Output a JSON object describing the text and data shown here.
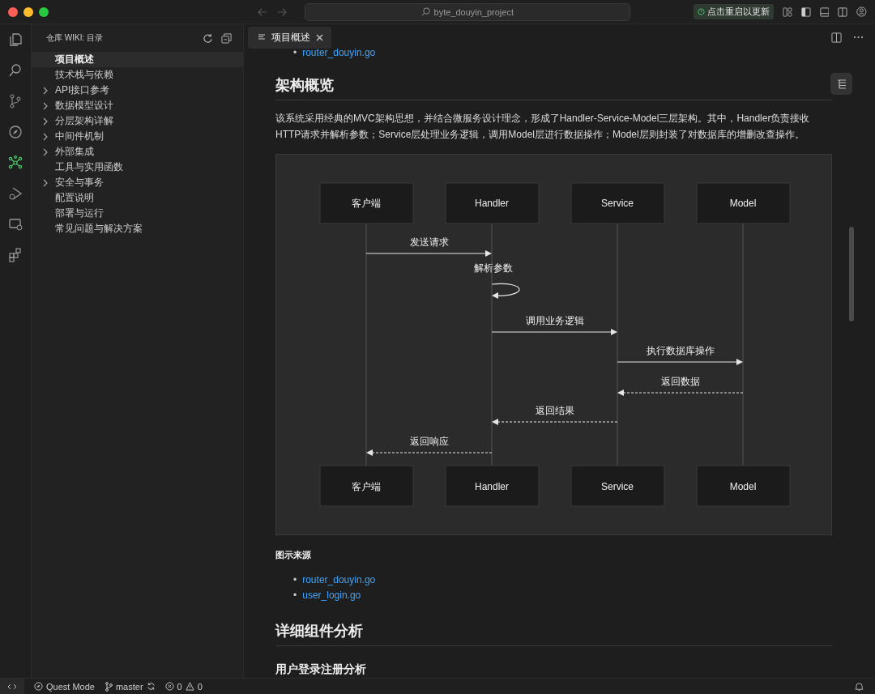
{
  "window": {
    "title": "byte_douyin_project",
    "update_badge": "点击重启以更新"
  },
  "sidebar": {
    "title": "仓库 WIKI: 目录",
    "items": [
      {
        "label": "项目概述",
        "expandable": false,
        "selected": true
      },
      {
        "label": "技术栈与依赖",
        "expandable": false,
        "selected": false
      },
      {
        "label": "API接口参考",
        "expandable": true,
        "selected": false
      },
      {
        "label": "数据模型设计",
        "expandable": true,
        "selected": false
      },
      {
        "label": "分层架构详解",
        "expandable": true,
        "selected": false
      },
      {
        "label": "中间件机制",
        "expandable": true,
        "selected": false
      },
      {
        "label": "外部集成",
        "expandable": true,
        "selected": false
      },
      {
        "label": "工具与实用函数",
        "expandable": false,
        "selected": false
      },
      {
        "label": "安全与事务",
        "expandable": true,
        "selected": false
      },
      {
        "label": "配置说明",
        "expandable": false,
        "selected": false
      },
      {
        "label": "部署与运行",
        "expandable": false,
        "selected": false
      },
      {
        "label": "常见问题与解决方案",
        "expandable": false,
        "selected": false
      }
    ]
  },
  "tabs": [
    {
      "label": "项目概述",
      "selected": true
    }
  ],
  "content": {
    "top_links": [
      {
        "bullet": "•",
        "text": "router_douyin.go"
      }
    ],
    "heading": "架构概览",
    "paragraph": "该系统采用经典的MVC架构思想，并结合微服务设计理念，形成了Handler-Service-Model三层架构。其中，Handler负责接收HTTP请求并解析参数；Service层处理业务逻辑，调用Model层进行数据操作；Model层则封装了对数据库的增删改查操作。",
    "diagram": {
      "participants": [
        "客户端",
        "Handler",
        "Service",
        "Model"
      ],
      "participants_bottom": [
        "客户端",
        "Handler",
        "Service",
        "Model"
      ],
      "messages": [
        {
          "label": "发送请求",
          "kind": "request"
        },
        {
          "label": "解析参数",
          "kind": "self"
        },
        {
          "label": "调用业务逻辑",
          "kind": "request"
        },
        {
          "label": "执行数据库操作",
          "kind": "request"
        },
        {
          "label": "返回数据",
          "kind": "return"
        },
        {
          "label": "返回结果",
          "kind": "return"
        },
        {
          "label": "返回响应",
          "kind": "return"
        }
      ]
    },
    "source_title": "图示来源",
    "source_links": [
      {
        "bullet": "•",
        "text": "router_douyin.go"
      },
      {
        "bullet": "•",
        "text": "user_login.go"
      }
    ],
    "heading2": "详细组件分析",
    "heading3": "用户登录注册分析"
  },
  "status_bar": {
    "mode": "Quest Mode",
    "branch": "master",
    "errors": "0",
    "warnings": "0"
  }
}
